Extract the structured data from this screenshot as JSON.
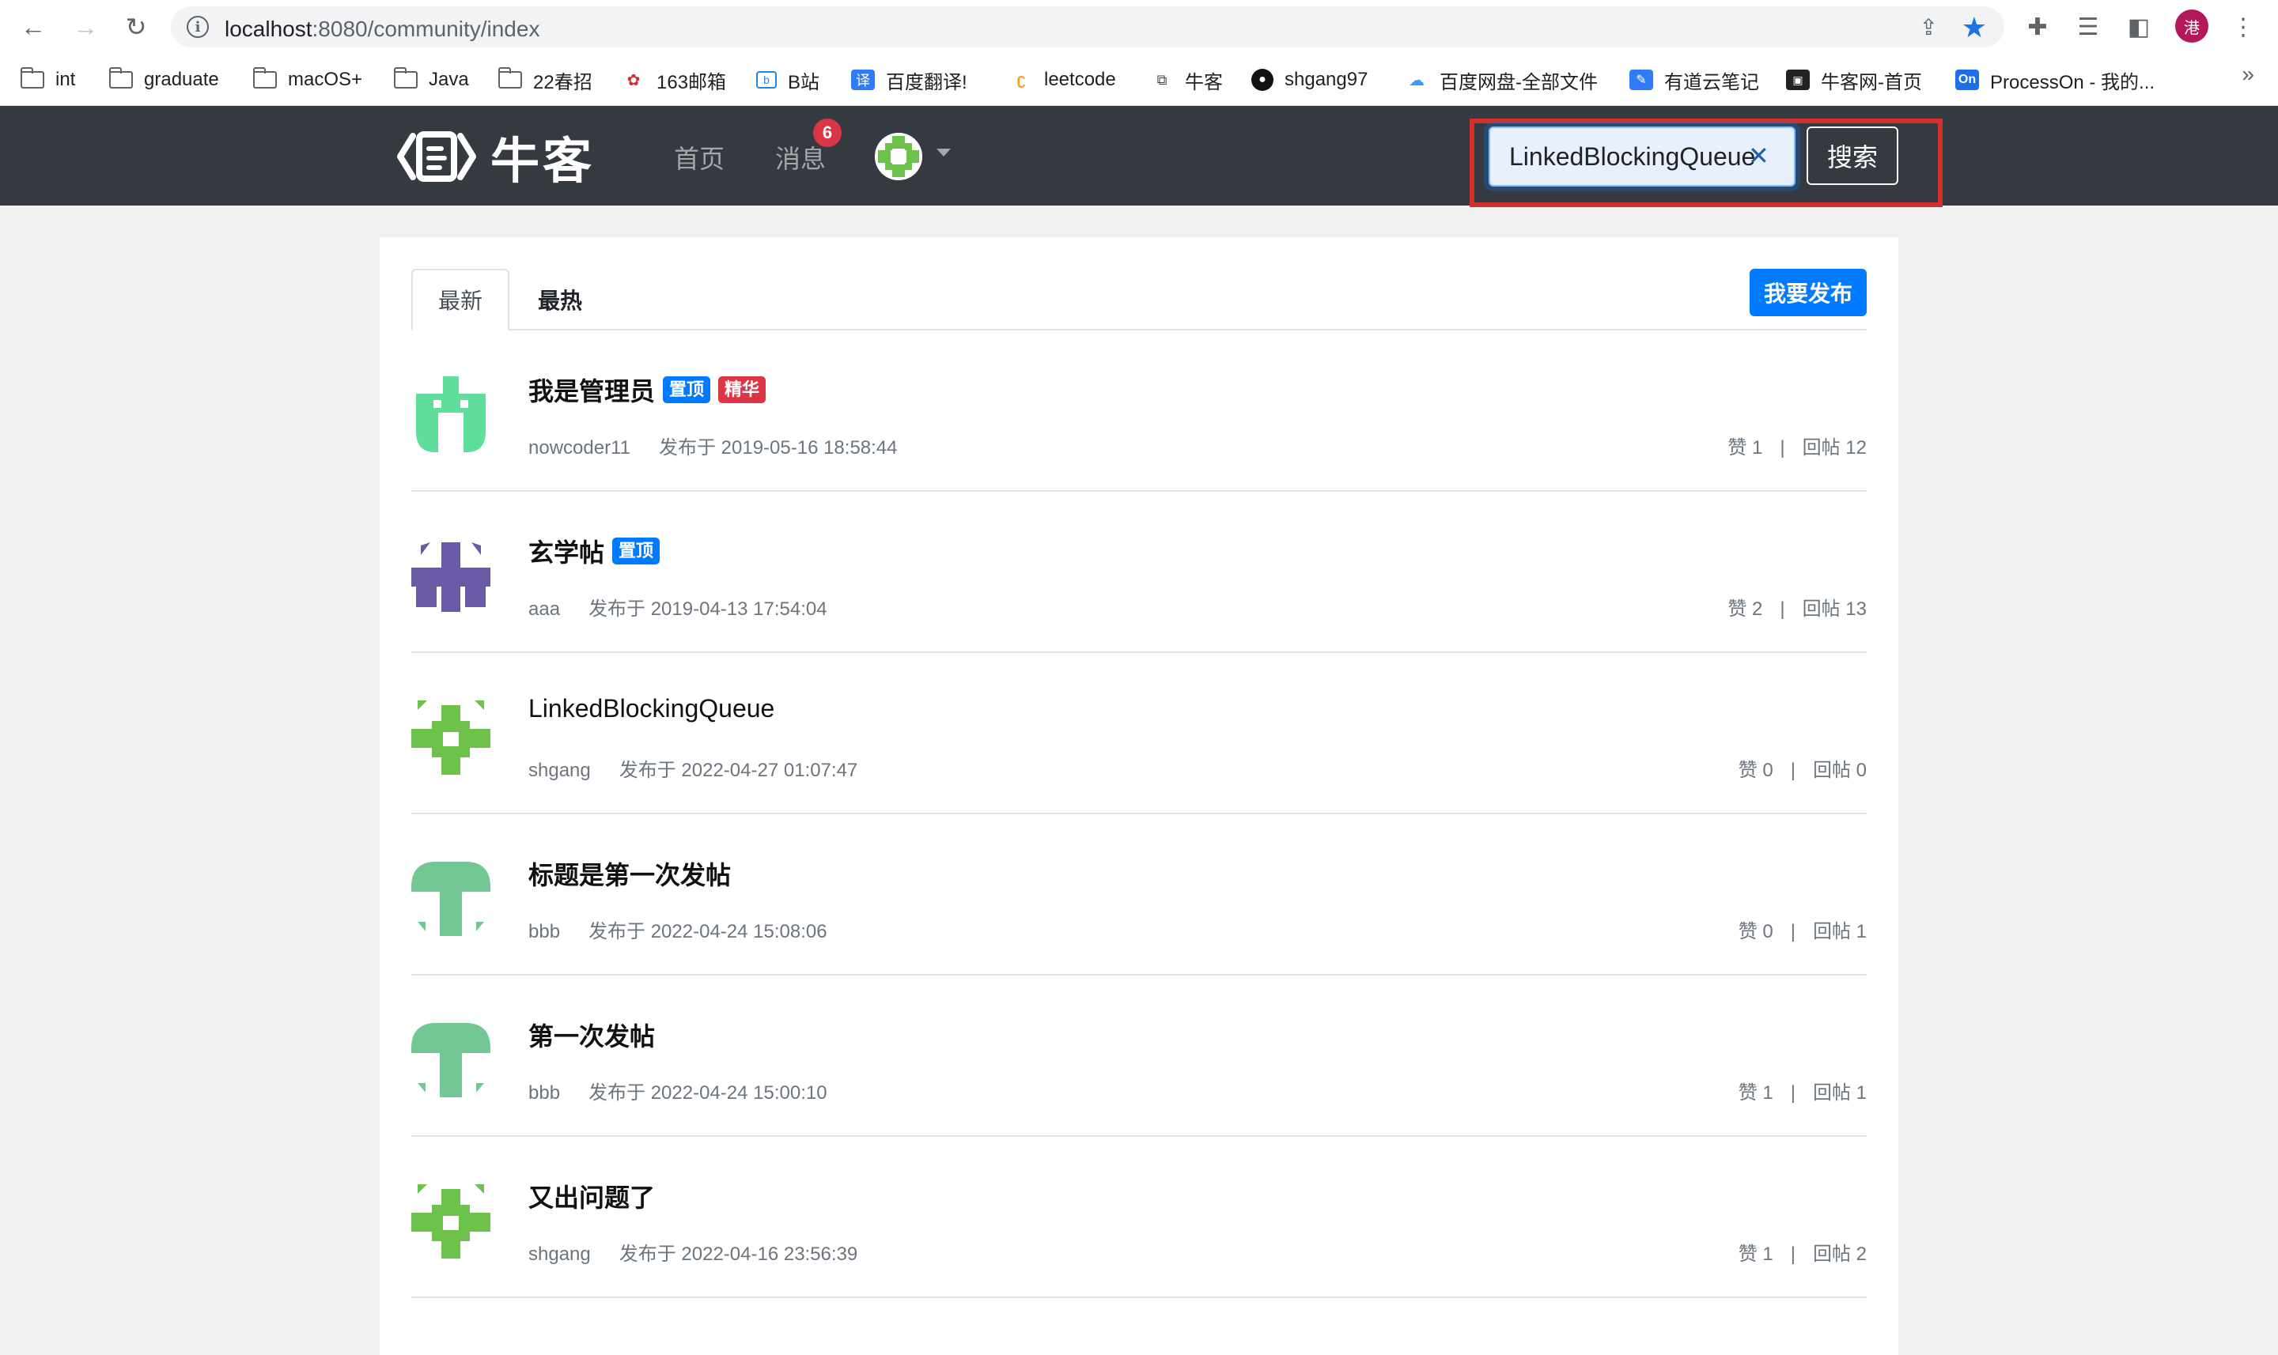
{
  "browser": {
    "url_host": "localhost",
    "url_rest": ":8080/community/index",
    "profile_initial": "港",
    "bookmarks": [
      {
        "label": "int",
        "type": "folder"
      },
      {
        "label": "graduate",
        "type": "folder"
      },
      {
        "label": "macOS+",
        "type": "folder"
      },
      {
        "label": "Java",
        "type": "folder"
      },
      {
        "label": "22春招",
        "type": "folder"
      },
      {
        "label": "163邮箱",
        "type": "site"
      },
      {
        "label": "B站",
        "type": "site"
      },
      {
        "label": "百度翻译!",
        "type": "site"
      },
      {
        "label": "leetcode",
        "type": "site"
      },
      {
        "label": "牛客",
        "type": "site"
      },
      {
        "label": "shgang97",
        "type": "site"
      },
      {
        "label": "百度网盘-全部文件",
        "type": "site"
      },
      {
        "label": "有道云笔记",
        "type": "site"
      },
      {
        "label": "牛客网-首页",
        "type": "site"
      },
      {
        "label": "ProcessOn - 我的...",
        "type": "site"
      }
    ],
    "more": "»"
  },
  "site": {
    "logo_text": "牛客",
    "nav_home": "首页",
    "nav_messages": "消息",
    "message_count": "6",
    "search_value": "LinkedBlockingQueue",
    "search_clear": "✕",
    "search_button": "搜索"
  },
  "tabs": {
    "latest": "最新",
    "hottest": "最热",
    "publish_button": "我要发布"
  },
  "labels": {
    "published_prefix": "发布于",
    "likes_prefix": "赞",
    "replies_prefix": "回帖",
    "separator": "|"
  },
  "posts": [
    {
      "title": "我是管理员",
      "badges": [
        "置顶",
        "精华"
      ],
      "author": "nowcoder11",
      "time": "发布于 2019-05-16 18:58:44",
      "likes": "赞 1",
      "replies": "回帖 12",
      "avatar": "mint"
    },
    {
      "title": "玄学帖",
      "badges": [
        "置顶"
      ],
      "author": "aaa",
      "time": "发布于 2019-04-13 17:54:04",
      "likes": "赞 2",
      "replies": "回帖 13",
      "avatar": "purple"
    },
    {
      "title": "LinkedBlockingQueue",
      "badges": [],
      "author": "shgang",
      "time": "发布于 2022-04-27 01:07:47",
      "likes": "赞 0",
      "replies": "回帖 0",
      "avatar": "green"
    },
    {
      "title": "标题是第一次发帖",
      "badges": [],
      "author": "bbb",
      "time": "发布于 2022-04-24 15:08:06",
      "likes": "赞 0",
      "replies": "回帖 1",
      "avatar": "sage"
    },
    {
      "title": "第一次发帖",
      "badges": [],
      "author": "bbb",
      "time": "发布于 2022-04-24 15:00:10",
      "likes": "赞 1",
      "replies": "回帖 1",
      "avatar": "sage"
    },
    {
      "title": "又出问题了",
      "badges": [],
      "author": "shgang",
      "time": "发布于 2022-04-16 23:56:39",
      "likes": "赞 1",
      "replies": "回帖 2",
      "avatar": "green"
    }
  ],
  "colors": {
    "header_bg": "#343a40",
    "primary": "#007bff",
    "danger": "#dc3545",
    "highlight_box": "#d0312d"
  }
}
